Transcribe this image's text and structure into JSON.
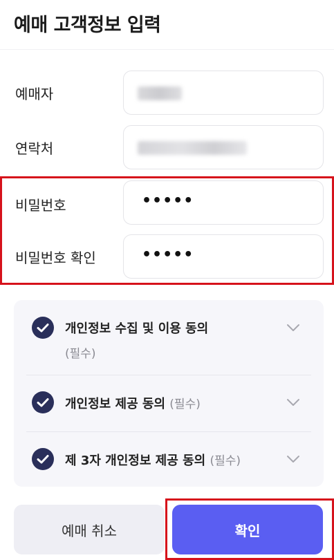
{
  "header": {
    "title": "예매 고객정보 입력"
  },
  "form": {
    "name_label": "예매자",
    "phone_label": "연락처",
    "password_label": "비밀번호",
    "password_value": "•••••",
    "password_confirm_label": "비밀번호 확인",
    "password_confirm_value": "•••••"
  },
  "agreements": {
    "items": [
      {
        "label": "개인정보 수집 및 이용 동의",
        "required": "(필수)",
        "checked": true
      },
      {
        "label": "개인정보 제공 동의",
        "required": "(필수)",
        "checked": true
      },
      {
        "label": "제 3자 개인정보 제공 동의",
        "required": "(필수)",
        "checked": true
      }
    ]
  },
  "buttons": {
    "cancel_label": "예매 취소",
    "confirm_label": "확인"
  },
  "colors": {
    "accent": "#5a5ef2",
    "check_fill": "#2a2f5a",
    "highlight": "#d6121b",
    "panel_bg": "#f6f6fa",
    "cancel_bg": "#eeeef4"
  }
}
